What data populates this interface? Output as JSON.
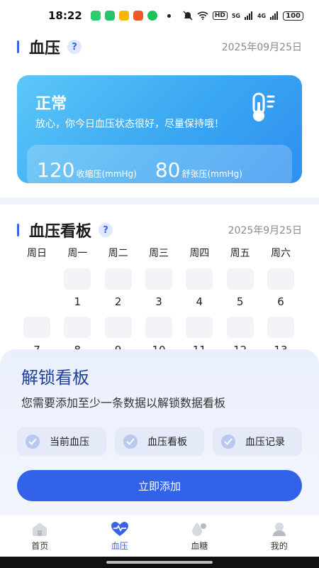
{
  "status_bar": {
    "time": "18:22",
    "network_badge": "HD",
    "signal_1": "5G",
    "signal_2": "4G",
    "battery": "100"
  },
  "bp_section": {
    "title": "血压",
    "help": "?",
    "date": "2025年09月25日"
  },
  "status_card": {
    "status": "正常",
    "message": "放心，你今日血压状态很好，尽量保持哦！",
    "systolic_value": "120",
    "systolic_label": "收缩压(mmHg)",
    "diastolic_value": "80",
    "diastolic_label": "舒张压(mmHg)",
    "icon": "thermometer-icon"
  },
  "board_section": {
    "title": "血压看板",
    "help": "?",
    "date": "2025年9月25日"
  },
  "calendar": {
    "weekdays": [
      "周日",
      "周一",
      "周二",
      "周三",
      "周四",
      "周五",
      "周六"
    ],
    "week1": [
      "",
      "1",
      "2",
      "3",
      "4",
      "5",
      "6"
    ],
    "week2": [
      "7",
      "8",
      "9",
      "10",
      "11",
      "12",
      "13"
    ]
  },
  "unlock_sheet": {
    "title": "解锁看板",
    "description": "您需要添加至少一条数据以解锁数据看板",
    "chips": [
      "当前血压",
      "血压看板",
      "血压记录"
    ],
    "cta": "立即添加"
  },
  "bottom_nav": {
    "items": [
      {
        "label": "首页",
        "icon": "home-icon"
      },
      {
        "label": "血压",
        "icon": "heart-pulse-icon"
      },
      {
        "label": "血糖",
        "icon": "blood-drop-icon"
      },
      {
        "label": "我的",
        "icon": "profile-icon"
      }
    ],
    "active_index": 1
  },
  "colors": {
    "accent": "#3a64e8",
    "card_gradient_start": "#5bc7f8",
    "card_gradient_end": "#2f8ff0"
  }
}
